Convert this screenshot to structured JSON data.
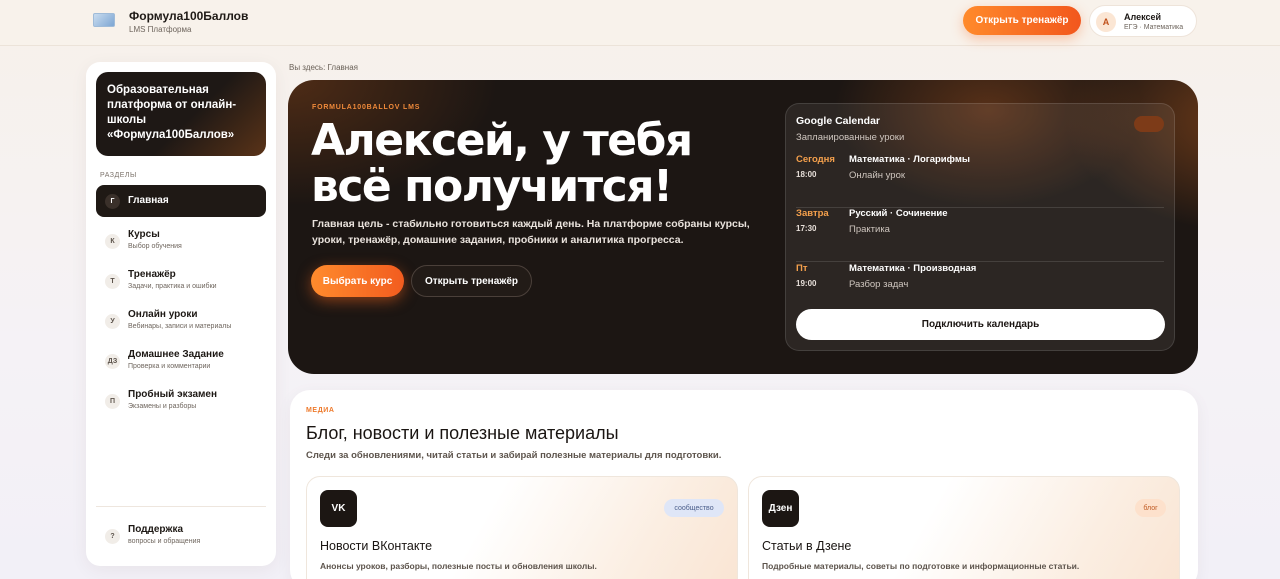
{
  "header": {
    "brand_name": "Формула100Баллов",
    "brand_sub": "LMS Платформа",
    "cta_label": "Открыть тренажёр",
    "user": {
      "initial": "А",
      "name": "Алексей",
      "sub": "ЕГЭ · Математика"
    }
  },
  "sidebar": {
    "hero_text": "Образовательная платформа от онлайн-школы «Формула100Баллов»",
    "section_label": "РАЗДЕЛЫ",
    "items": [
      {
        "badge": "Г",
        "title": "Главная",
        "desc": ""
      },
      {
        "badge": "К",
        "title": "Курсы",
        "desc": "Выбор обучения"
      },
      {
        "badge": "Т",
        "title": "Тренажёр",
        "desc": "Задачи, практика и ошибки"
      },
      {
        "badge": "У",
        "title": "Онлайн уроки",
        "desc": "Вебинары, записи и материалы"
      },
      {
        "badge": "ДЗ",
        "title": "Домашнее Задание",
        "desc": "Проверка и комментарии"
      },
      {
        "badge": "П",
        "title": "Пробный экзамен",
        "desc": "Экзамены и разборы"
      }
    ],
    "support": {
      "badge": "?",
      "title": "Поддержка",
      "desc": "вопросы и обращения"
    }
  },
  "breadcrumb": "Вы здесь: Главная",
  "hero": {
    "eyebrow": "FORMULA100BALLOV LMS",
    "title": "Алексей, у тебя всё получится!",
    "text": "Главная цель - стабильно готовиться каждый день. На платформе собраны курсы, уроки, тренажёр, домашние задания, пробники и аналитика прогресса.",
    "primary_button": "Выбрать курс",
    "secondary_button": "Открыть тренажёр"
  },
  "calendar": {
    "title": "Google Calendar",
    "subtitle": "Запланированные уроки",
    "pill": "",
    "events": [
      {
        "day": "Сегодня",
        "time": "18:00",
        "subject": "Математика · Логарифмы",
        "type": "Онлайн урок"
      },
      {
        "day": "Завтра",
        "time": "17:30",
        "subject": "Русский · Сочинение",
        "type": "Практика"
      },
      {
        "day": "Пт",
        "time": "19:00",
        "subject": "Математика · Производная",
        "type": "Разбор задач"
      }
    ],
    "connect_button": "Подключить календарь"
  },
  "media": {
    "eyebrow": "МЕДИА",
    "title": "Блог, новости и полезные материалы",
    "subtitle": "Следи за обновлениями, читай статьи и забирай полезные материалы для подготовки.",
    "cards": [
      {
        "logo": "VK",
        "tag": "сообщество",
        "tag_color": "#dfe6f7",
        "tag_text_color": "#4a5d8a",
        "title": "Новости ВКонтакте",
        "desc": "Анонсы уроков, разборы, полезные посты и обновления школы."
      },
      {
        "logo": "Дзен",
        "tag": "блог",
        "tag_color": "#fde1cc",
        "tag_text_color": "#c05a22",
        "title": "Статьи в Дзене",
        "desc": "Подробные материалы, советы по подготовке и информационные статьи."
      }
    ]
  },
  "colors": {
    "accent": "#f5702a",
    "dark": "#1c1613"
  }
}
